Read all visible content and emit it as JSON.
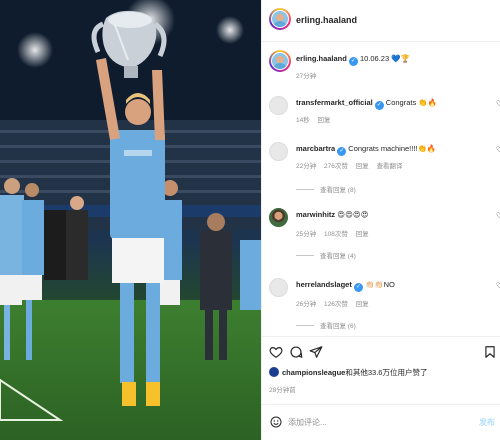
{
  "post": {
    "author": "erling.haaland",
    "caption_date": "10.06.23",
    "caption_emoji": "💙🏆",
    "caption_age": "27分钟"
  },
  "comments": [
    {
      "user": "transfermarkt_official",
      "verified": true,
      "text": "Congrats 👏🔥",
      "age": "14秒",
      "likes": "",
      "reply": "回复",
      "translate": "",
      "replies": ""
    },
    {
      "user": "marcbartra",
      "verified": true,
      "text": "Congrats machine!!!!👏🔥",
      "age": "22分钟",
      "likes": "276次赞",
      "reply": "回复",
      "translate": "查看翻译",
      "replies": "查看回复 (8)"
    },
    {
      "user": "marwinhitz",
      "verified": false,
      "text": "😍😍😍😍",
      "age": "25分钟",
      "likes": "108次赞",
      "reply": "回复",
      "translate": "",
      "replies": "查看回复 (4)"
    },
    {
      "user": "herrelandslaget",
      "verified": true,
      "text": "👏🏻👏🏻NO",
      "age": "26分钟",
      "likes": "126次赞",
      "reply": "回复",
      "translate": "",
      "replies": "查看回复 (6)"
    }
  ],
  "actions": {
    "likes_user": "championsleague",
    "likes_text": "和其他33.6万位用户赞了",
    "post_age": "28分钟前"
  },
  "composer": {
    "placeholder": "添加评论...",
    "post_label": "发布"
  },
  "colors": {
    "accent": "#3897f0",
    "muted": "#8e8e8e",
    "city_blue": "#6cabdd"
  }
}
